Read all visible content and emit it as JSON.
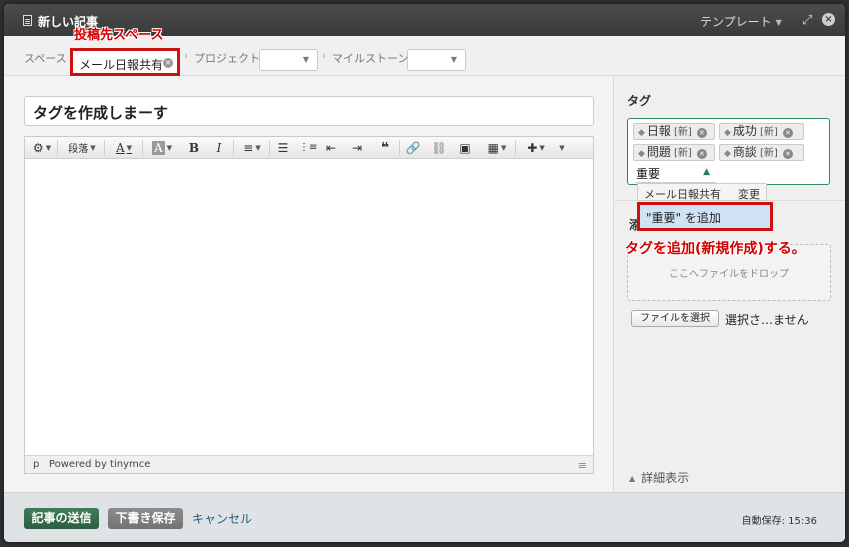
{
  "window": {
    "title": "新しい記事",
    "template_label": "テンプレート",
    "expand_glyph": "⤢",
    "close_glyph": "×"
  },
  "breadcrumb": {
    "space_label": "スペース",
    "space_value": "メール日報共有",
    "project_label": "プロジェクト",
    "project_value": "",
    "milestone_label": "マイルストーン",
    "milestone_value": "",
    "sep_glyph": "›"
  },
  "annotations": {
    "space_callout": "投稿先スペース",
    "tag_callout": "タグを追加(新規作成)する。"
  },
  "editor": {
    "title_value": "タグを作成しまーす",
    "toolbar": {
      "paragraph_label": "段落",
      "bold": "B",
      "italic": "I",
      "font_color": "A",
      "bg_color": "A",
      "quote": "❝",
      "icons": [
        "gear-icon",
        "bullet-list-icon",
        "numbered-list-icon",
        "outdent-icon",
        "indent-icon",
        "link-icon",
        "unlink-icon",
        "image-icon",
        "table-icon",
        "plugin-icon"
      ]
    },
    "status_path": "p",
    "powered_by": "Powered by tinymce"
  },
  "sidebar": {
    "tags_heading": "タグ",
    "tags": [
      {
        "label": "日報",
        "badge": "[新]"
      },
      {
        "label": "成功",
        "badge": "[新]"
      },
      {
        "label": "問題",
        "badge": "[新]"
      },
      {
        "label": "商談",
        "badge": "[新]"
      }
    ],
    "tag_input_value": "重要",
    "suggestion": {
      "space": "メール日報共有",
      "change": "変更"
    },
    "add_option": "\"重要\" を追加",
    "hidden_label": "添",
    "dropzone_text": "ここへファイルをドロップ",
    "file_button": "ファイルを選択",
    "file_status": "選択さ…ません",
    "details_toggle": "詳細表示"
  },
  "footer": {
    "send": "記事の送信",
    "draft": "下書き保存",
    "cancel": "キャンセル",
    "autosave": "自動保存: 15:36"
  },
  "colors": {
    "accent_green": "#2e8b57",
    "annotation_red": "#cc1111",
    "highlight_blue": "#cfe3f5"
  }
}
